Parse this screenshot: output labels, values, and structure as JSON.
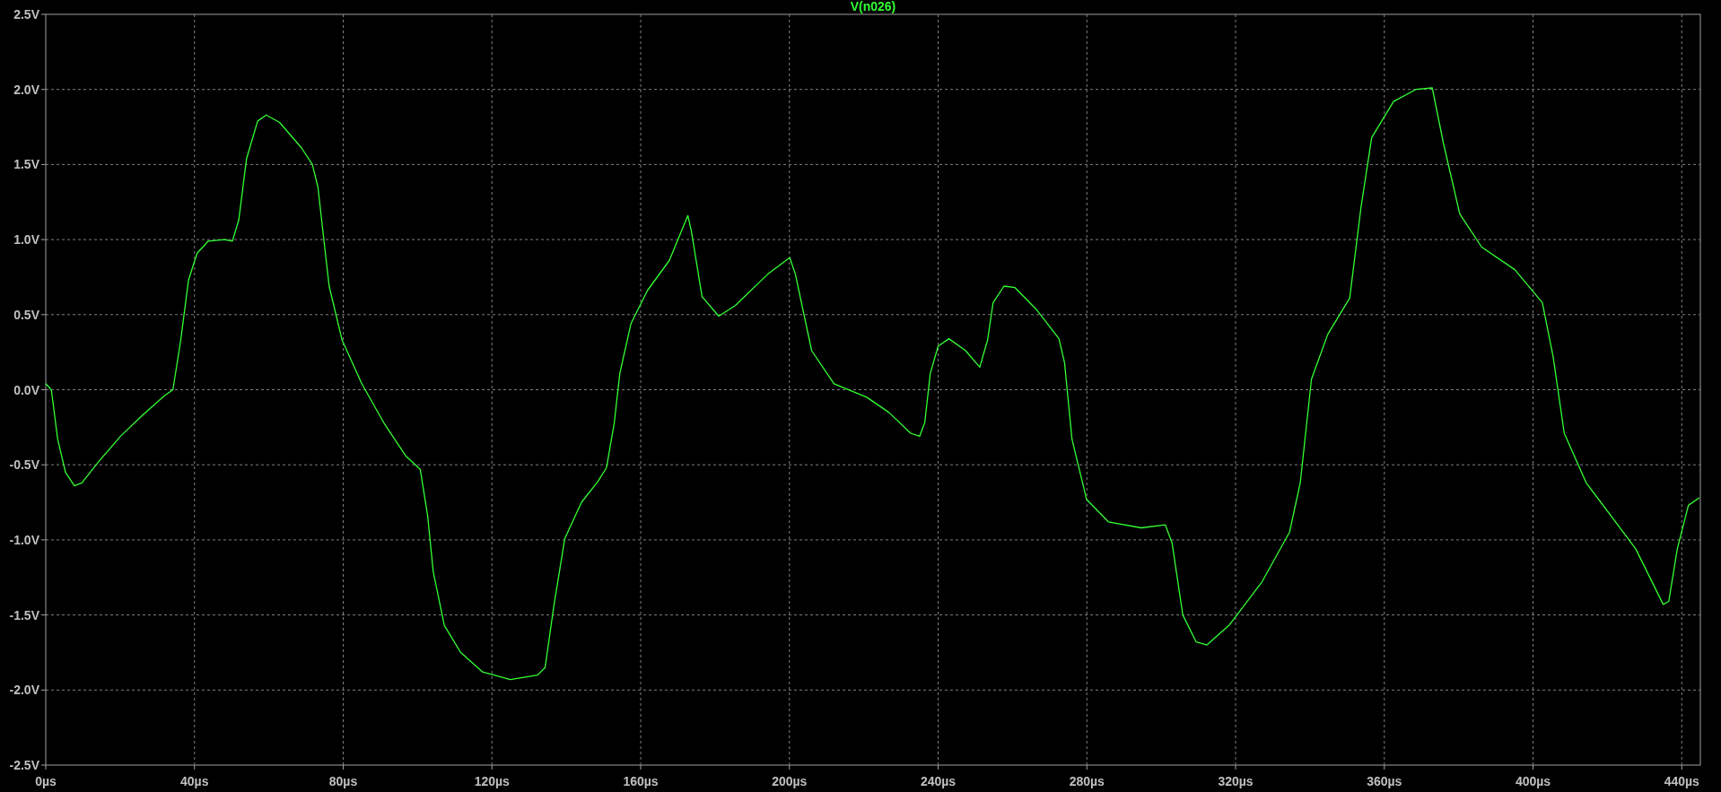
{
  "plot": {
    "chart_data": {
      "type": "line",
      "grid": true,
      "xlim": [
        0,
        445
      ],
      "ylim": [
        -2.5,
        2.5
      ],
      "xticks": [
        {
          "value": 0,
          "label": "0µs"
        },
        {
          "value": 40,
          "label": "40µs"
        },
        {
          "value": 80,
          "label": "80µs"
        },
        {
          "value": 120,
          "label": "120µs"
        },
        {
          "value": 160,
          "label": "160µs"
        },
        {
          "value": 200,
          "label": "200µs"
        },
        {
          "value": 240,
          "label": "240µs"
        },
        {
          "value": 280,
          "label": "280µs"
        },
        {
          "value": 320,
          "label": "320µs"
        },
        {
          "value": 360,
          "label": "360µs"
        },
        {
          "value": 400,
          "label": "400µs"
        },
        {
          "value": 440,
          "label": "440µs"
        }
      ],
      "yticks": [
        {
          "value": 2.5,
          "label": "2.5V"
        },
        {
          "value": 2,
          "label": "2.0V"
        },
        {
          "value": 1.5,
          "label": "1.5V"
        },
        {
          "value": 1,
          "label": "1.0V"
        },
        {
          "value": 0.5,
          "label": "0.5V"
        },
        {
          "value": 0,
          "label": "0.0V"
        },
        {
          "value": -0.5,
          "label": "-0.5V"
        },
        {
          "value": -1,
          "label": "-1.0V"
        },
        {
          "value": -1.5,
          "label": "-1.5V"
        },
        {
          "value": -2,
          "label": "-2.0V"
        },
        {
          "value": -2.5,
          "label": "-2.5V"
        }
      ],
      "x": [
        0,
        1.5,
        3.2,
        5.3,
        7.7,
        9.7,
        14.2,
        20.1,
        26,
        31.9,
        34.2,
        36.3,
        38.4,
        40.7,
        43.7,
        48.1,
        50.2,
        51.9,
        54,
        57,
        59.3,
        62.9,
        68.8,
        71.7,
        73.2,
        76.2,
        79.7,
        85,
        90.9,
        96.8,
        100.7,
        102.7,
        104.2,
        107.2,
        111.6,
        117.5,
        124.9,
        132.3,
        134.3,
        136.7,
        139.6,
        144.1,
        148.5,
        150.8,
        152.9,
        154.4,
        157.4,
        161.8,
        167.7,
        172.7,
        173.6,
        176.5,
        181,
        185.4,
        194.2,
        200.1,
        201.6,
        206,
        212,
        220.8,
        226.7,
        232.6,
        235,
        236.4,
        237.9,
        240,
        242.9,
        247.4,
        251.2,
        253.3,
        254.8,
        257.7,
        260.7,
        266.6,
        272.5,
        274,
        276,
        279.9,
        285.8,
        294.6,
        301.1,
        302.9,
        305.8,
        309.4,
        312.3,
        318.2,
        327.1,
        334.5,
        337.4,
        340.4,
        344.8,
        350.7,
        353.7,
        356.6,
        362.5,
        368.5,
        372.9,
        375.9,
        380.3,
        386.2,
        395.1,
        402.5,
        405.4,
        408.4,
        414.3,
        427.6,
        435,
        436.5,
        438.8,
        441.8,
        444.7
      ],
      "series": [
        {
          "name": "V(n026)",
          "color": "#33ff33",
          "values": [
            0.04,
            0,
            -0.33,
            -0.55,
            -0.64,
            -0.62,
            -0.48,
            -0.31,
            -0.17,
            -0.04,
            0,
            0.33,
            0.73,
            0.91,
            0.99,
            1,
            0.99,
            1.13,
            1.54,
            1.79,
            1.83,
            1.78,
            1.61,
            1.5,
            1.35,
            0.69,
            0.33,
            0.04,
            -0.22,
            -0.44,
            -0.53,
            -0.84,
            -1.21,
            -1.57,
            -1.75,
            -1.88,
            -1.93,
            -1.9,
            -1.85,
            -1.43,
            -0.99,
            -0.75,
            -0.61,
            -0.52,
            -0.22,
            0.11,
            0.44,
            0.66,
            0.86,
            1.16,
            1.06,
            0.62,
            0.49,
            0.56,
            0.77,
            0.88,
            0.77,
            0.26,
            0.04,
            -0.05,
            -0.15,
            -0.29,
            -0.31,
            -0.22,
            0.11,
            0.29,
            0.34,
            0.26,
            0.15,
            0.33,
            0.58,
            0.69,
            0.68,
            0.53,
            0.34,
            0.18,
            -0.33,
            -0.73,
            -0.88,
            -0.92,
            -0.9,
            -1.02,
            -1.5,
            -1.68,
            -1.7,
            -1.57,
            -1.28,
            -0.95,
            -0.62,
            0.07,
            0.37,
            0.61,
            1.21,
            1.68,
            1.92,
            2,
            2.01,
            1.64,
            1.17,
            0.95,
            0.8,
            0.58,
            0.22,
            -0.29,
            -0.62,
            -1.06,
            -1.43,
            -1.41,
            -1.06,
            -0.77,
            -0.72
          ]
        }
      ]
    }
  }
}
